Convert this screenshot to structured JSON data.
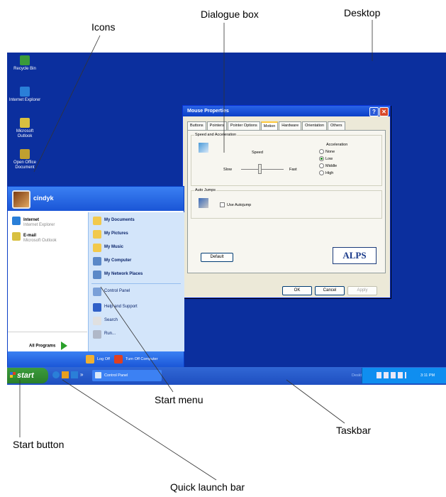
{
  "callouts": {
    "icons": "Icons",
    "dialogue_box": "Dialogue box",
    "desktop": "Desktop",
    "start_menu": "Start menu",
    "taskbar": "Taskbar",
    "start_button": "Start button",
    "quick_launch_bar": "Quick launch bar"
  },
  "desktop_icons": [
    {
      "label": "Recycle Bin",
      "icon": "recycle-bin-icon",
      "color": "#3a9a3a"
    },
    {
      "label": "Internet Explorer",
      "icon": "internet-explorer-icon",
      "color": "#2a7fd8"
    },
    {
      "label": "Microsoft Outlook",
      "icon": "outlook-icon",
      "color": "#d8c040"
    },
    {
      "label": "Open Office Document",
      "icon": "open-office-icon",
      "color": "#c0a030"
    }
  ],
  "dialog": {
    "title": "Mouse Properties",
    "help": "?",
    "close": "✕",
    "tabs": [
      "Buttons",
      "Pointers",
      "Pointer Options",
      "Motion",
      "Hardware",
      "Orientation",
      "Others"
    ],
    "active_tab": "Motion",
    "speed_group": "Speed and Acceleration",
    "speed_label": "Speed",
    "slow": "Slow",
    "fast": "Fast",
    "acceleration_label": "Acceleration",
    "acceleration_options": [
      "None",
      "Low",
      "Middle",
      "High"
    ],
    "acceleration_selected": "Low",
    "autojump_group": "Auto Jumps",
    "use_autojump": "Use Autojump",
    "default_button": "Default",
    "brand": "ALPS",
    "ok": "OK",
    "cancel": "Cancel",
    "apply": "Apply"
  },
  "start_menu": {
    "user": "cindyk",
    "pinned": [
      {
        "title": "Internet",
        "sub": "Internet Explorer",
        "icon": "internet-explorer-icon",
        "color": "#2a7fd8"
      },
      {
        "title": "E-mail",
        "sub": "Microsoft Outlook",
        "icon": "outlook-icon",
        "color": "#d8c040"
      }
    ],
    "all_programs": "All Programs",
    "right_items": [
      {
        "label": "My Documents",
        "icon": "folder-icon",
        "color": "#f2c94c",
        "bold": true
      },
      {
        "label": "My Pictures",
        "icon": "folder-icon",
        "color": "#f2c94c",
        "bold": true
      },
      {
        "label": "My Music",
        "icon": "folder-icon",
        "color": "#f2c94c",
        "bold": true
      },
      {
        "label": "My Computer",
        "icon": "computer-icon",
        "color": "#5a88c8",
        "bold": true
      },
      {
        "label": "My Network Places",
        "icon": "network-icon",
        "color": "#5a88c8",
        "bold": true
      },
      {
        "label": "Control Panel",
        "icon": "control-panel-icon",
        "color": "#7aa0d8",
        "bold": false
      },
      {
        "label": "Help and Support",
        "icon": "help-icon",
        "color": "#3060c8",
        "bold": false
      },
      {
        "label": "Search",
        "icon": "search-icon",
        "color": "#e0e0e0",
        "bold": false
      },
      {
        "label": "Run...",
        "icon": "run-icon",
        "color": "#b0b8c8",
        "bold": false
      }
    ],
    "log_off": "Log Off",
    "turn_off": "Turn Off Computer"
  },
  "taskbar": {
    "start": "start",
    "task": "Control Panel",
    "desktop_label": "Desktop",
    "clock": "3:11 PM"
  },
  "colors": {
    "desktop": "#0b2f9e",
    "taskbar": "#245edb",
    "start_button": "#3a963a"
  }
}
